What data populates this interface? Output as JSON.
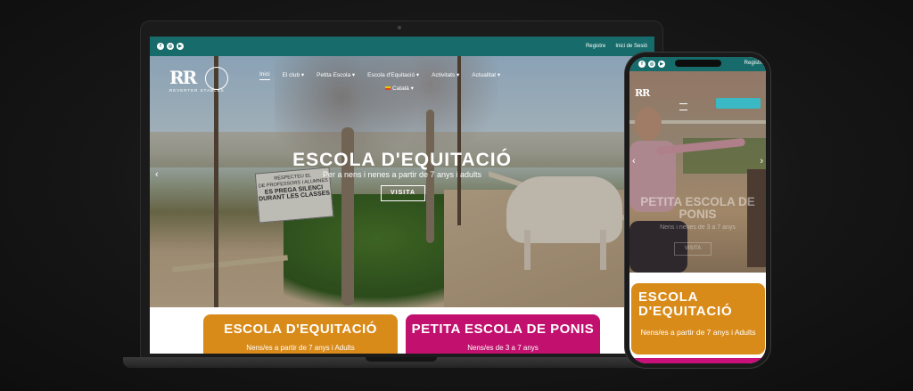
{
  "laptop": {
    "topbar": {
      "social": [
        "f",
        "◎",
        "▶"
      ],
      "links": [
        "Registre",
        "Inici de Sesió"
      ]
    },
    "logo": {
      "mark": "RR",
      "sub": "REVERTER STABLES"
    },
    "nav": [
      "Inici",
      "El club",
      "Petita Escola",
      "Escola d'Equitació",
      "Activitats",
      "Actualitat"
    ],
    "language": "Català",
    "hero": {
      "title": "ESCOLA D'EQUITACIÓ",
      "subtitle": "Per a nens i nenes a partir de 7 anys i adults",
      "button": "VISITA"
    },
    "sign": [
      "RESPECTEU EL",
      "DE PROFESSORS I ALUMNES",
      "ES PREGA SILENCI",
      "DURANT LES CLASSES"
    ],
    "cards": [
      {
        "title": "ESCOLA D'EQUITACIÓ",
        "subtitle": "Nens/es a partir de 7 anys i Adults",
        "color": "#d98b1a"
      },
      {
        "title": "PETITA ESCOLA DE PONIS",
        "subtitle": "Nens/es de 3 a 7 anys",
        "color": "#c2106e"
      }
    ]
  },
  "phone": {
    "topbar": {
      "social": [
        "f",
        "◎",
        "▶"
      ],
      "link": "Registre"
    },
    "hero": {
      "title": "PETITA ESCOLA DE PONIS",
      "subtitle": "Nens i nenes de 3 a 7 anys"
    },
    "card": {
      "title": "ESCOLA D'EQUITACIÓ",
      "subtitle": "Nens/es a partir de 7 anys i Adults",
      "color": "#d98b1a"
    }
  }
}
